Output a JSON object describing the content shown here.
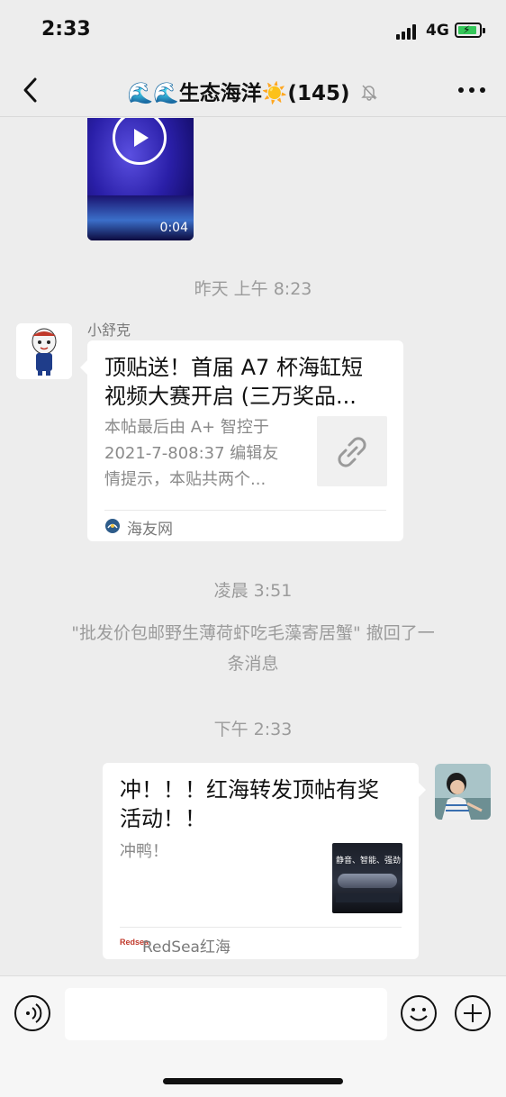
{
  "status": {
    "time": "2:33",
    "network": "4G",
    "battery_color": "#34c759"
  },
  "header": {
    "title": "🌊🌊生态海洋☀️(145)",
    "back_icon": "chevron-left-icon",
    "mute_icon": "bell-slash-icon",
    "more_icon": "ellipsis-icon"
  },
  "messages": {
    "video": {
      "duration": "0:04",
      "play_icon": "play-icon"
    },
    "time_1": "昨天 上午 8:23",
    "link_card": {
      "sender": "小舒克",
      "title_line1": "顶贴送！首届 A7 杯海缸短",
      "title_line2": "视频大赛开启 (三万奖品...",
      "desc_line1": "本帖最后由 A+ 智控于",
      "desc_line2": "2021-7-808:37 编辑友",
      "desc_line3": "情提示，本贴共两个...",
      "thumb_icon": "link-icon",
      "source": "海友网"
    },
    "time_2": "凌晨 3:51",
    "recall_line1": "\"批发价包邮野生薄荷虾吃毛藻寄居蟹\" 撤回了一",
    "recall_line2": "条消息",
    "time_3": "下午 2:33",
    "own_card": {
      "title_line1": "冲！！！红海转发顶帖有奖",
      "title_line2": "活动！！",
      "desc": "冲鸭！",
      "thumb_text": "静音、智能、强劲",
      "source_logo": "Redsea",
      "source": "RedSea红海"
    }
  },
  "input_bar": {
    "voice_icon": "voice-icon",
    "emoji_icon": "emoji-icon",
    "plus_icon": "plus-icon",
    "message_value": ""
  },
  "colors": {
    "background": "#ededed",
    "bubble": "#ffffff",
    "muted_text": "#9b9b9b"
  }
}
